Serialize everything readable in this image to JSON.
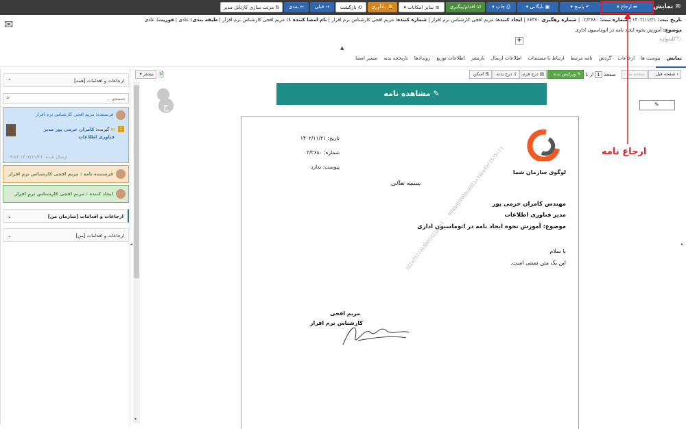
{
  "toolbar": {
    "title": "نمایش",
    "erja": "ارجاع",
    "pasokh": "پاسخ",
    "baygani": "بایگانی",
    "chap": "چاپ",
    "eghdam": "اقدام/پیگیری",
    "sayer": "سایر امکانات",
    "yadavari": "یادآوری",
    "bazgasht": "بازگشت",
    "ghabli": "قبلی",
    "badi": "بعدی",
    "sort": "مرتب سازی کارتابل مدیر"
  },
  "header": {
    "date_label": "تاریخ ثبت:",
    "date_value": "۱۴۰۲/۱۱/۲۱",
    "num_label": "شماره ثبت:",
    "num_value": "۰۲/۲۶۸۰",
    "track_label": "شماره رهگیری",
    "track_value": "۶۶۳۷۰",
    "creator_label": "ایجاد کننده:",
    "creator_value": "مریم افجی کارشناس نرم افزار",
    "sender_label": "شماره کننده:",
    "sender_value": "مریم افجی کارشناس نرم افزار",
    "signer_label": "نام امضا کننده ۱:",
    "signer_value": "مریم افجی کارشناس نرم افزار",
    "class_label": "طبقه بندی:",
    "class_value": "عادی",
    "urgency_label": "فوریت:",
    "urgency_value": "عادی",
    "subject_label": "موضوع:",
    "subject_value": "آموزش نحوه ایجاد نامه در اتوماسیون اداری",
    "keyword": "کلیدواژه"
  },
  "tabs": [
    "نمایش",
    "پیوست ها",
    "ارجاعات",
    "گردش",
    "نامه مرتبط",
    "ارتباط با مستندات",
    "اطلاعات ارسال",
    "بازنشر",
    "اطلاعات توزیع",
    "رویدادها",
    "تاریخچه بدنه",
    "مسیر امضا"
  ],
  "doc_toolbar": {
    "prev_page": "صفحه قبل",
    "next_page": "صفحه بعد",
    "page_label": "صفحه",
    "page_value": "1",
    "of_label": "از 1",
    "edit_body": "ویرایش بدنه",
    "form_insert": "درج فرم",
    "body_insert": "درج بدنه",
    "scan": "اسکن",
    "more": "بیشتر"
  },
  "left_panel": {
    "all_title": "ارجاعات و اقدامات [همه]",
    "search_placeholder": "جستجو ...",
    "card1_sender": "فرستنده: مریم افجی کارشناس نرم افزار",
    "card1_badge": "1",
    "card1_receiver_label": "گیرنده:",
    "card1_receiver": "کامران خرمی پور مدیر فناوری اطلاعات",
    "card1_sent": "ارسال شده: ۱۴۰۲/۱۱/۲۱ ۰۹:۵۶",
    "card2": "فرستنده نامه : مریم افجی کارشناس نرم افزار",
    "card3": "ایجاد کننده : مریم افجی کارشناس نرم افزار",
    "org_title": "ارجاعات و اقدامات [سازمان من]",
    "me_title": "ارجاعات و اقدامات [من]"
  },
  "document": {
    "banner": "مشاهده نامه",
    "logo_caption": "لوگوی سازمان شما",
    "date": "تاریخ: ۱۴۰۲/۱۱/۲۱",
    "number": "شماره: ۰۲/۲۶۸۰",
    "attachment": "پیوست: ندارد",
    "bismillah": "بسمه تعالی",
    "recipient_name": "مهندس کامران خرمی پور",
    "recipient_title": "مدیر فناوری اطلاعات",
    "subject": "موضوع: آموزش نحوه ایجاد نامه در اتوماسیون اداری",
    "greeting": "با سلام",
    "body": "این یک متن تستی است.",
    "signer_name": "مریم افجی",
    "signer_title": "کارشناس نرم افزار",
    "watermark": "322a7021408665421babf - 00abdb9995e2021a34ba4ef1575c11"
  },
  "annotation": "ارجاع نامه",
  "colors": {
    "toolbar_bg": "#3a3a3a",
    "primary": "#2f67b1",
    "banner": "#1e8d85",
    "annotation": "#e2202a",
    "card_blue": "#cfe5f7",
    "card_orange": "#fbe6cc",
    "card_green": "#d7ecd3"
  }
}
